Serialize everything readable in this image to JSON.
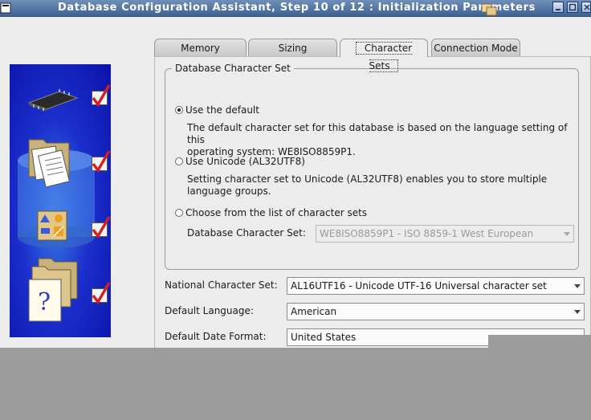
{
  "window": {
    "title": "Database Configuration Assistant, Step 10 of 12 : Initialization Parameters"
  },
  "tabs": [
    {
      "label": "Memory"
    },
    {
      "label": "Sizing"
    },
    {
      "label": "Character Sets"
    },
    {
      "label": "Connection Mode"
    }
  ],
  "active_tab": "Character Sets",
  "db_charset": {
    "group_title": "Database Character Set",
    "options": [
      {
        "label": "Use the default",
        "selected": true,
        "description_line1": "The default character set for this database is based on the language setting of this",
        "description_line2": "operating system: WE8ISO8859P1."
      },
      {
        "label": "Use Unicode (AL32UTF8)",
        "selected": false,
        "description_line1": "Setting character set to Unicode (AL32UTF8) enables you to store multiple",
        "description_line2": "language groups."
      },
      {
        "label": "Choose from the list of character sets",
        "selected": false
      }
    ],
    "list_label": "Database Character Set:",
    "list_value": "WE8ISO8859P1 - ISO 8859-1 West European"
  },
  "fields": [
    {
      "label": "National Character Set:",
      "value": "AL16UTF16 - Unicode UTF-16 Universal character set"
    },
    {
      "label": "Default Language:",
      "value": "American"
    },
    {
      "label": "Default Date Format:",
      "value": "United States"
    }
  ],
  "colors": {
    "titlebar": "#3f6294",
    "side_panel": "#1b2fcc",
    "check_mark": "#d42020"
  },
  "icons": [
    "chip-icon",
    "documents-icon",
    "shapes-icon",
    "help-documents-icon",
    "checkmark-icon"
  ]
}
